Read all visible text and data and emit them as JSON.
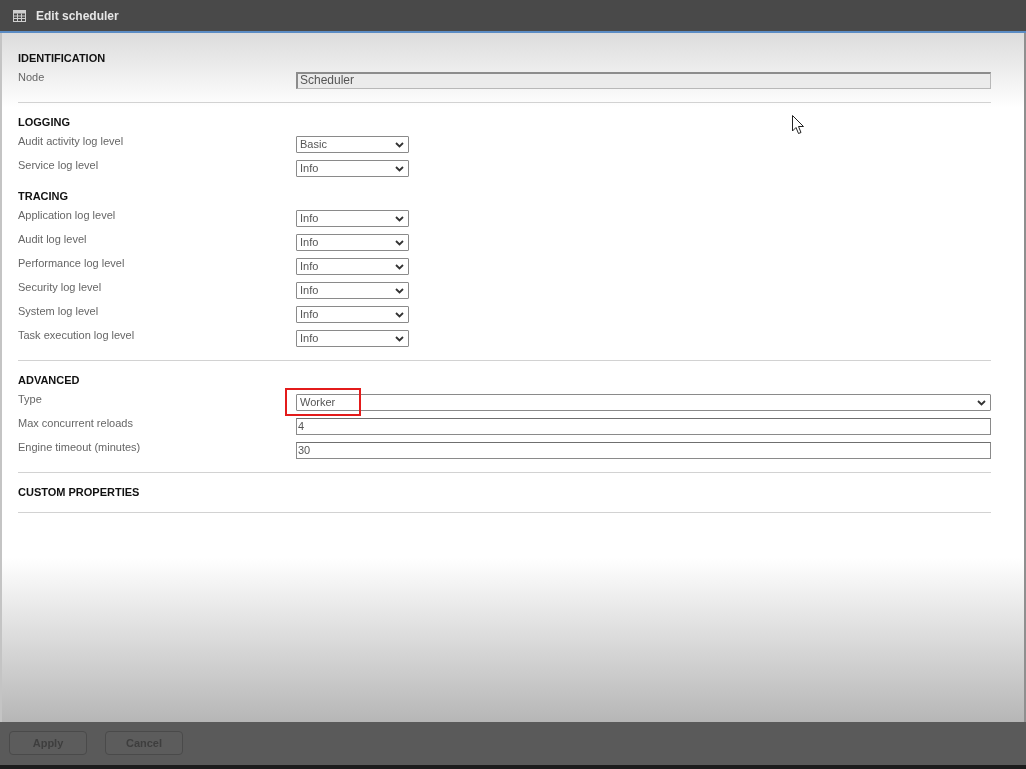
{
  "window": {
    "title": "Edit scheduler"
  },
  "groups": [
    {
      "sections": [
        {
          "heading": "IDENTIFICATION",
          "fields": [
            {
              "label": "Node",
              "kind": "readonly",
              "value": "Scheduler",
              "highlighted": false
            }
          ]
        }
      ]
    },
    {
      "sections": [
        {
          "heading": "LOGGING",
          "fields": [
            {
              "label": "Audit activity log level",
              "kind": "select",
              "value": "Basic",
              "highlighted": false
            },
            {
              "label": "Service log level",
              "kind": "select",
              "value": "Info",
              "highlighted": false
            }
          ]
        },
        {
          "heading": "TRACING",
          "fields": [
            {
              "label": "Application log level",
              "kind": "select",
              "value": "Info",
              "highlighted": false
            },
            {
              "label": "Audit log level",
              "kind": "select",
              "value": "Info",
              "highlighted": false
            },
            {
              "label": "Performance log level",
              "kind": "select",
              "value": "Info",
              "highlighted": false
            },
            {
              "label": "Security log level",
              "kind": "select",
              "value": "Info",
              "highlighted": false
            },
            {
              "label": "System log level",
              "kind": "select",
              "value": "Info",
              "highlighted": false
            },
            {
              "label": "Task execution log level",
              "kind": "select",
              "value": "Info",
              "highlighted": false
            }
          ]
        }
      ]
    },
    {
      "sections": [
        {
          "heading": "ADVANCED",
          "fields": [
            {
              "label": "Type",
              "kind": "combo",
              "value": "Worker",
              "highlighted": true
            },
            {
              "label": "Max concurrent reloads",
              "kind": "number",
              "value": "4",
              "highlighted": false
            },
            {
              "label": "Engine timeout (minutes)",
              "kind": "number",
              "value": "30",
              "highlighted": false
            }
          ]
        }
      ]
    },
    {
      "sections": [
        {
          "heading": "CUSTOM PROPERTIES"
        }
      ]
    }
  ],
  "buttons": [
    {
      "label": "Apply",
      "disabled": true
    },
    {
      "label": "Cancel",
      "disabled": true
    }
  ]
}
